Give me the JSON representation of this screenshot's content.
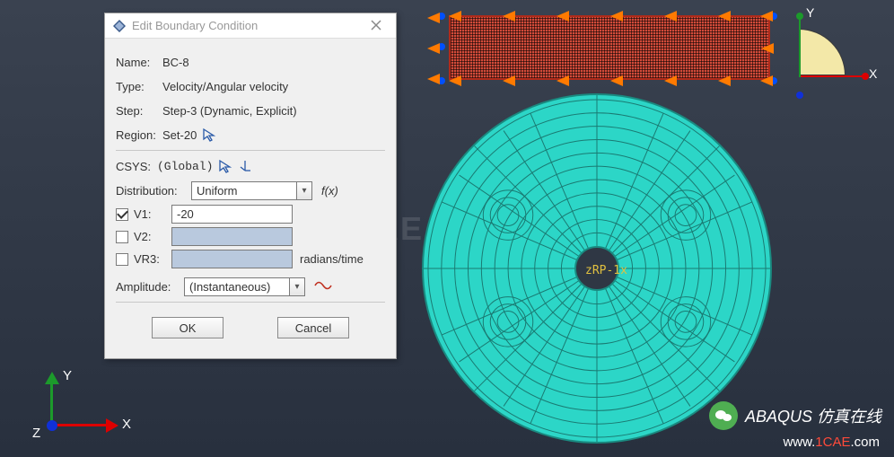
{
  "dialog": {
    "title": "Edit Boundary Condition",
    "name_label": "Name:",
    "name_value": "BC-8",
    "type_label": "Type:",
    "type_value": "Velocity/Angular velocity",
    "step_label": "Step:",
    "step_value": "Step-3 (Dynamic, Explicit)",
    "region_label": "Region:",
    "region_value": "Set-20",
    "csys_label": "CSYS:",
    "csys_value": "(Global)",
    "dist_label": "Distribution:",
    "dist_value": "Uniform",
    "fx_label": "f(x)",
    "v1_label": "V1:",
    "v1_value": "-20",
    "v2_label": "V2:",
    "vr3_label": "VR3:",
    "unit_radians": "radians/time",
    "amp_label": "Amplitude:",
    "amp_value": "(Instantaneous)",
    "ok": "OK",
    "cancel": "Cancel"
  },
  "axes": {
    "x": "X",
    "y": "Y",
    "z": "Z"
  },
  "rp_label": "zRP-1x",
  "watermark": "1CAE",
  "brand": "ABAQUS 仿真在线",
  "url_prefix": "www.",
  "url_red": "1CAE",
  "url_suffix": ".com"
}
